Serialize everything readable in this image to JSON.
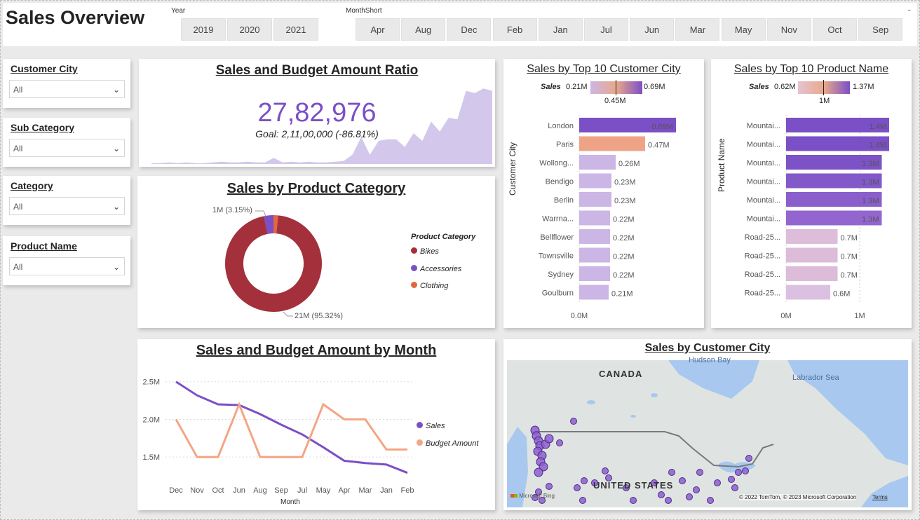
{
  "app_title": "Sales Overview",
  "filters": {
    "year": {
      "caption": "Year",
      "options": [
        "2019",
        "2020",
        "2021"
      ]
    },
    "month": {
      "caption": "MonthShort",
      "options": [
        "Apr",
        "Aug",
        "Dec",
        "Feb",
        "Jan",
        "Jul",
        "Jun",
        "Mar",
        "May",
        "Nov",
        "Oct",
        "Sep"
      ]
    }
  },
  "slicers": [
    {
      "title": "Customer City",
      "value": "All"
    },
    {
      "title": "Sub Category",
      "value": "All"
    },
    {
      "title": "Category",
      "value": "All"
    },
    {
      "title": "Product Name",
      "value": "All"
    }
  ],
  "kpi": {
    "title": "Sales and Budget Amount Ratio",
    "value": "27,82,976",
    "goal": "Goal: 2,11,00,000 (-86.81%)",
    "trend": [
      0.01,
      0.01,
      0.02,
      0.01,
      0.02,
      0.01,
      0.01,
      0.02,
      0.03,
      0.02,
      0.02,
      0.03,
      0.02,
      0.02,
      0.08,
      0.02,
      0.03,
      0.02,
      0.03,
      0.02,
      0.02,
      0.03,
      0.04,
      0.12,
      0.35,
      0.12,
      0.3,
      0.32,
      0.32,
      0.22,
      0.4,
      0.3,
      0.55,
      0.42,
      0.6,
      0.58,
      0.95,
      0.92,
      0.98,
      0.95
    ]
  },
  "colors": {
    "purple": "#7b4fc6",
    "bikes": "#a4303b",
    "accessories": "#7b4fc6",
    "clothing": "#e3663d",
    "budget": "#f4a584",
    "paris": "#eea387",
    "light_purple": "#cbb6e6",
    "kpi_area": "#d3c8ec"
  },
  "donut": {
    "title": "Sales by Product Category",
    "legend_title": "Product Category",
    "label_small": "1M (3.15%)",
    "label_big": "21M (95.32%)",
    "chart_data": {
      "type": "pie",
      "categories": [
        "Bikes",
        "Accessories",
        "Clothing"
      ],
      "values": [
        95.32,
        3.15,
        1.53
      ]
    }
  },
  "city_bar": {
    "title": "Sales by Top 10 Customer City",
    "scale_label": "Sales",
    "scale_min": "0.21M",
    "scale_max": "0.69M",
    "scale_mid": "0.45M",
    "ylabel": "Customer City",
    "ticks": [
      "0.0M",
      "0.5M"
    ],
    "chart_data": {
      "type": "bar",
      "categories": [
        "London",
        "Paris",
        "Wollong...",
        "Bendigo",
        "Berlin",
        "Warrna...",
        "Bellflower",
        "Townsville",
        "Sydney",
        "Goulburn"
      ],
      "values": [
        0.69,
        0.47,
        0.26,
        0.23,
        0.23,
        0.22,
        0.22,
        0.22,
        0.22,
        0.21
      ],
      "labels": [
        "0.69M",
        "0.47M",
        "0.26M",
        "0.23M",
        "0.23M",
        "0.22M",
        "0.22M",
        "0.22M",
        "0.22M",
        "0.21M"
      ],
      "xlim": [
        0,
        0.8
      ],
      "ylabel": "Customer City"
    }
  },
  "product_bar": {
    "title": "Sales by Top 10 Product Name",
    "scale_label": "Sales",
    "scale_min": "0.62M",
    "scale_max": "1.37M",
    "scale_mid": "1M",
    "ylabel": "Product Name",
    "ticks": [
      "0M",
      "1M"
    ],
    "chart_data": {
      "type": "bar",
      "categories": [
        "Mountai...",
        "Mountai...",
        "Mountai...",
        "Mountai...",
        "Mountai...",
        "Mountai...",
        "Road-25...",
        "Road-25...",
        "Road-25...",
        "Road-25..."
      ],
      "values": [
        1.4,
        1.4,
        1.3,
        1.3,
        1.3,
        1.3,
        0.7,
        0.7,
        0.7,
        0.6
      ],
      "labels": [
        "1.4M",
        "1.4M",
        "1.3M",
        "1.3M",
        "1.3M",
        "1.3M",
        "0.7M",
        "0.7M",
        "0.7M",
        "0.6M"
      ],
      "xlim": [
        0,
        1.6
      ],
      "ylabel": "Product Name"
    }
  },
  "line": {
    "title": "Sales and Budget Amount by Month",
    "xlabel": "Month",
    "yticks": [
      "2.5M",
      "2.0M",
      "1.5M"
    ],
    "chart_data": {
      "type": "line",
      "x": [
        "Dec",
        "Nov",
        "Oct",
        "Jun",
        "Aug",
        "Sep",
        "Jul",
        "May",
        "Apr",
        "Mar",
        "Jan",
        "Feb"
      ],
      "ylim": [
        1.25,
        2.6
      ],
      "series": [
        {
          "name": "Sales",
          "values": [
            2.5,
            2.32,
            2.2,
            2.19,
            2.07,
            1.93,
            1.8,
            1.63,
            1.45,
            1.42,
            1.4,
            1.29
          ]
        },
        {
          "name": "Budget Amount",
          "values": [
            2.0,
            1.5,
            1.5,
            2.2,
            1.5,
            1.5,
            1.5,
            2.2,
            2.0,
            2.0,
            1.6,
            1.6
          ]
        }
      ]
    }
  },
  "map": {
    "title": "Sales by Customer City",
    "labels": {
      "canada": "CANADA",
      "us": "UNITED STATES",
      "hudson": "Hudson Bay",
      "labrador": "Labrador Sea"
    },
    "credit": "© 2022 TomTom, © 2023 Microsoft Corporation",
    "terms": "Terms",
    "brand": "Microsoft Bing"
  }
}
